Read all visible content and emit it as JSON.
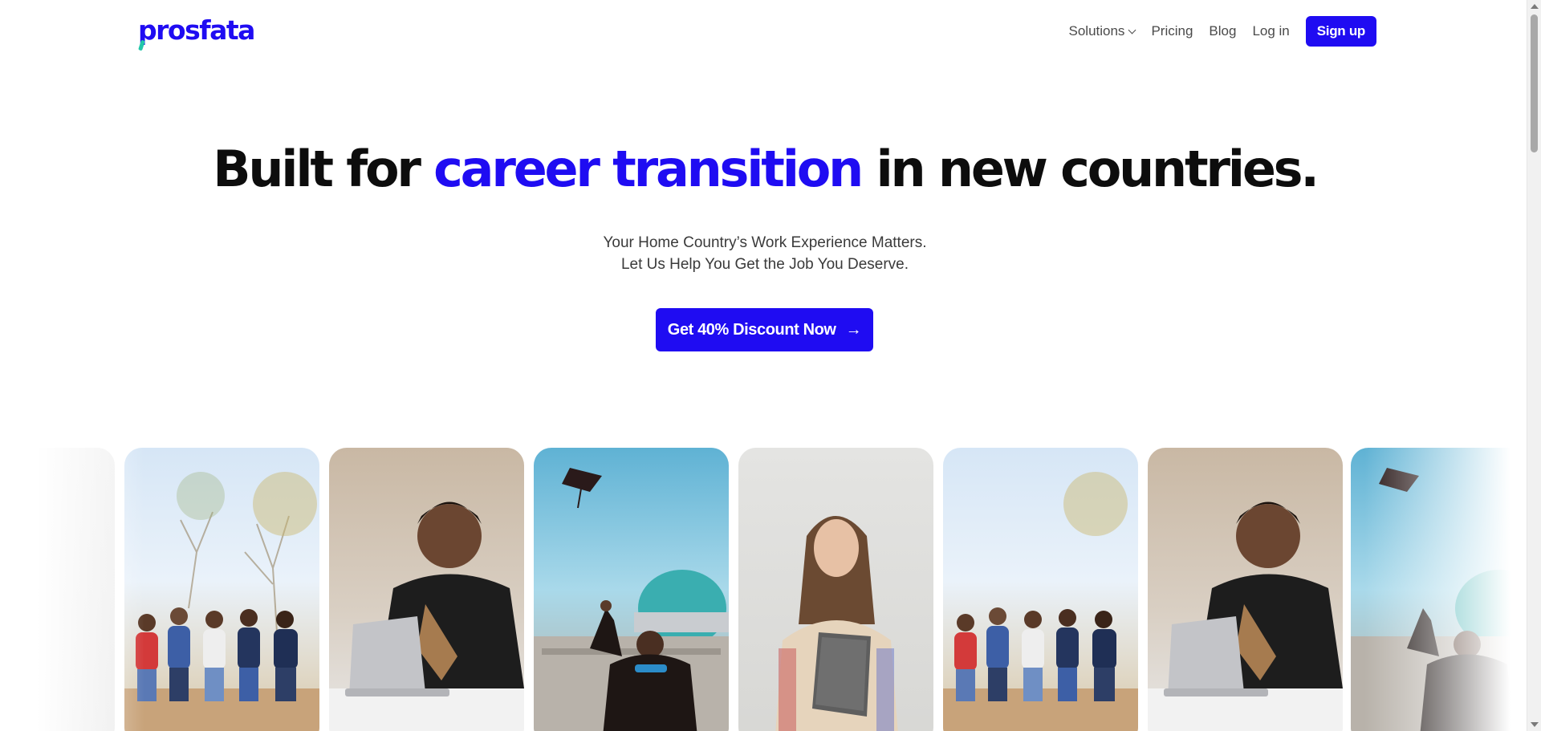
{
  "header": {
    "logo_text": "prosfata",
    "nav": {
      "solutions": "Solutions",
      "pricing": "Pricing",
      "blog": "Blog",
      "login": "Log in",
      "signup": "Sign up"
    }
  },
  "hero": {
    "title_before": "Built for ",
    "title_accent": "career transition",
    "title_after": " in new countries.",
    "subtitle_line1": "Your  Home Country’s Work Experience Matters.",
    "subtitle_line2": "Let Us Help You Get the Job You Deserve.",
    "cta_label": "Get 40% Discount Now",
    "cta_icon": "→"
  },
  "carousel": {
    "images": [
      "students-group-bench",
      "man-smiling-laptop",
      "graduate-tossing-cap",
      "woman-reading-tablet",
      "students-group-bench",
      "man-smiling-laptop",
      "graduate-tossing-cap"
    ]
  },
  "colors": {
    "brand": "#1f0cf2",
    "accent_green": "#22c7a9",
    "text": "#0d0d0d",
    "muted": "#4a4a4a"
  }
}
